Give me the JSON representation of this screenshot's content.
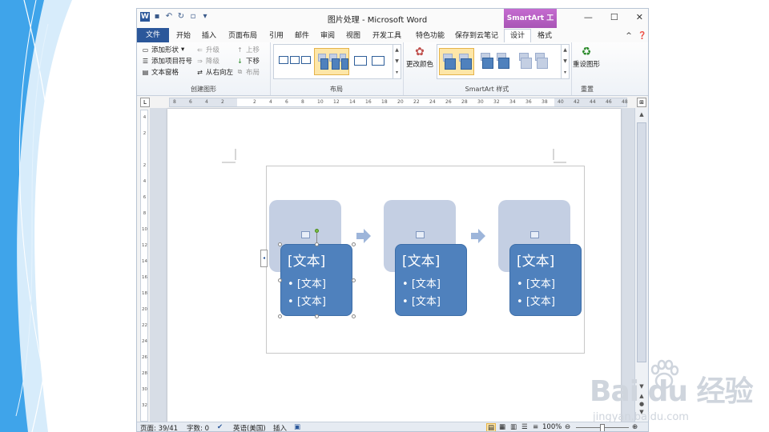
{
  "app": {
    "title": "图片处理 - Microsoft Word",
    "contextual_tab": "SmartArt 工具",
    "logo": "W"
  },
  "tabs": [
    "文件",
    "开始",
    "插入",
    "页面布局",
    "引用",
    "邮件",
    "审阅",
    "视图",
    "开发工具",
    "特色功能",
    "保存到云笔记",
    "设计",
    "格式"
  ],
  "selected_tab": "设计",
  "ribbon": {
    "create_group": {
      "label": "创建图形",
      "add_shape": "添加形状",
      "add_bullet": "添加项目符号",
      "text_pane": "文本窗格",
      "promote": "升级",
      "demote": "降级",
      "right_to_left": "从右向左",
      "move_up": "上移",
      "move_down": "下移",
      "layout_btn": "布局"
    },
    "layout_group": {
      "label": "布局"
    },
    "styles_group": {
      "label": "SmartArt 样式",
      "change_colors": "更改颜色"
    },
    "reset_group": {
      "label": "重置",
      "reset_graphic": "重设图形"
    }
  },
  "ruler_h_ticks": [
    "8",
    "6",
    "4",
    "2",
    "",
    "2",
    "4",
    "6",
    "8",
    "10",
    "12",
    "14",
    "16",
    "18",
    "20",
    "22",
    "24",
    "26",
    "28",
    "30",
    "32",
    "34",
    "36",
    "38",
    "40",
    "42",
    "44",
    "46",
    "48"
  ],
  "ruler_v_ticks": [
    "4",
    "2",
    "",
    "2",
    "4",
    "6",
    "8",
    "10",
    "12",
    "14",
    "16",
    "18",
    "20",
    "22",
    "24",
    "26",
    "28",
    "30",
    "32"
  ],
  "smartart": {
    "items": [
      {
        "title": "[文本]",
        "bullets": [
          "[文本]",
          "[文本]"
        ]
      },
      {
        "title": "[文本]",
        "bullets": [
          "[文本]",
          "[文本]"
        ]
      },
      {
        "title": "[文本]",
        "bullets": [
          "[文本]",
          "[文本]"
        ]
      }
    ],
    "bullet_char": "•"
  },
  "status": {
    "page": "页面: 39/41",
    "words": "字数: 0",
    "language": "英语(美国)",
    "mode": "插入",
    "zoom": "100%"
  },
  "watermark": {
    "brand": "Bai du 经验",
    "site": "jingyan.baidu.com"
  },
  "colors": {
    "accent_blue": "#2b579a",
    "smartart_fill": "#4f81bd",
    "smartart_light": "#c4cfe3",
    "contextual": "#a855b5"
  }
}
